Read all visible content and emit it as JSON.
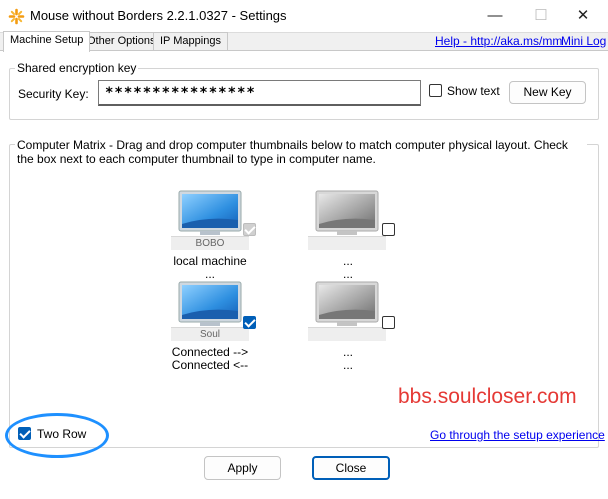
{
  "window": {
    "title": "Mouse without Borders 2.2.1.0327 - Settings",
    "minimize_glyph": "—",
    "maximize_glyph": "☐",
    "close_glyph": "✕"
  },
  "tabs": [
    {
      "label": "Machine Setup",
      "active": true
    },
    {
      "label": "Other Options",
      "active": false
    },
    {
      "label": "IP Mappings",
      "active": false
    }
  ],
  "links": {
    "help": "Help - http://aka.ms/mm",
    "mini_log": "Mini Log",
    "setup": "Go through the setup experience"
  },
  "encryption": {
    "legend": "Shared encryption key",
    "security_label": "Security Key:",
    "key_value": "****************",
    "show_text_label": "Show text",
    "new_key_label": "New Key"
  },
  "matrix": {
    "legend": "Computer Matrix  - Drag and drop computer thumbnails below to match computer physical layout. Check the box next to each computer thumbnail to type in computer name.",
    "machines": [
      {
        "name": "BOBO",
        "status1": "local machine",
        "status2": "...",
        "active": true,
        "checked": true,
        "disabled": true
      },
      {
        "name": "",
        "status1": "...",
        "status2": "...",
        "active": false,
        "checked": false,
        "disabled": false
      },
      {
        "name": "Soul",
        "status1": "Connected -->",
        "status2": "Connected <--",
        "active": true,
        "checked": true,
        "disabled": false
      },
      {
        "name": "",
        "status1": "...",
        "status2": "...",
        "active": false,
        "checked": false,
        "disabled": false
      }
    ]
  },
  "two_row": {
    "label": "Two Row",
    "checked": true
  },
  "buttons": {
    "apply": "Apply",
    "close": "Close"
  },
  "watermark": "bbs.soulcloser.com",
  "colors": {
    "accent": "#005fb8",
    "link": "#0000ee",
    "watermark": "#e53935",
    "highlight": "#1e90ff"
  }
}
